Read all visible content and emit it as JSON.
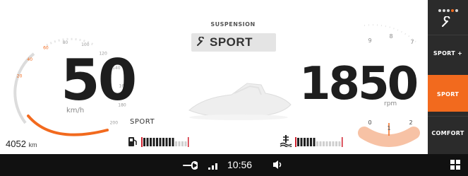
{
  "speed": {
    "value": "50",
    "unit": "km/h",
    "scale_labels": [
      "20",
      "40",
      "60",
      "80",
      "100",
      "120",
      "140",
      "160",
      "180",
      "200"
    ]
  },
  "odometer": {
    "value": "4052",
    "unit": "km"
  },
  "drive_mode_label": "SPORT",
  "suspension": {
    "title": "SUSPENSION",
    "value": "SPORT",
    "icon": "wrench-icon"
  },
  "rpm": {
    "value": "1850",
    "unit": "rpm",
    "scale_labels": [
      "9",
      "8",
      "7"
    ]
  },
  "trim": {
    "labels": [
      "0",
      "1",
      "2"
    ],
    "level_fraction": 0.5
  },
  "fuel": {
    "icon": "fuel-pump-icon",
    "level_fraction": 0.7
  },
  "trim_bar": {
    "icon": "trim-icon",
    "level_fraction": 0.45
  },
  "mode_panel": {
    "buttons": [
      "SPORT +",
      "SPORT",
      "COMFORT"
    ],
    "active": "SPORT",
    "top_icon": "wrench-icon"
  },
  "status_bar": {
    "time": "10:56",
    "icons": [
      "wrench-icon",
      "signal-icon",
      "volume-icon",
      "grid-icon"
    ]
  },
  "colors": {
    "accent": "#f26a1e",
    "panel": "#2b2b2b",
    "status_bar": "#111111",
    "text": "#1e1e1e"
  }
}
